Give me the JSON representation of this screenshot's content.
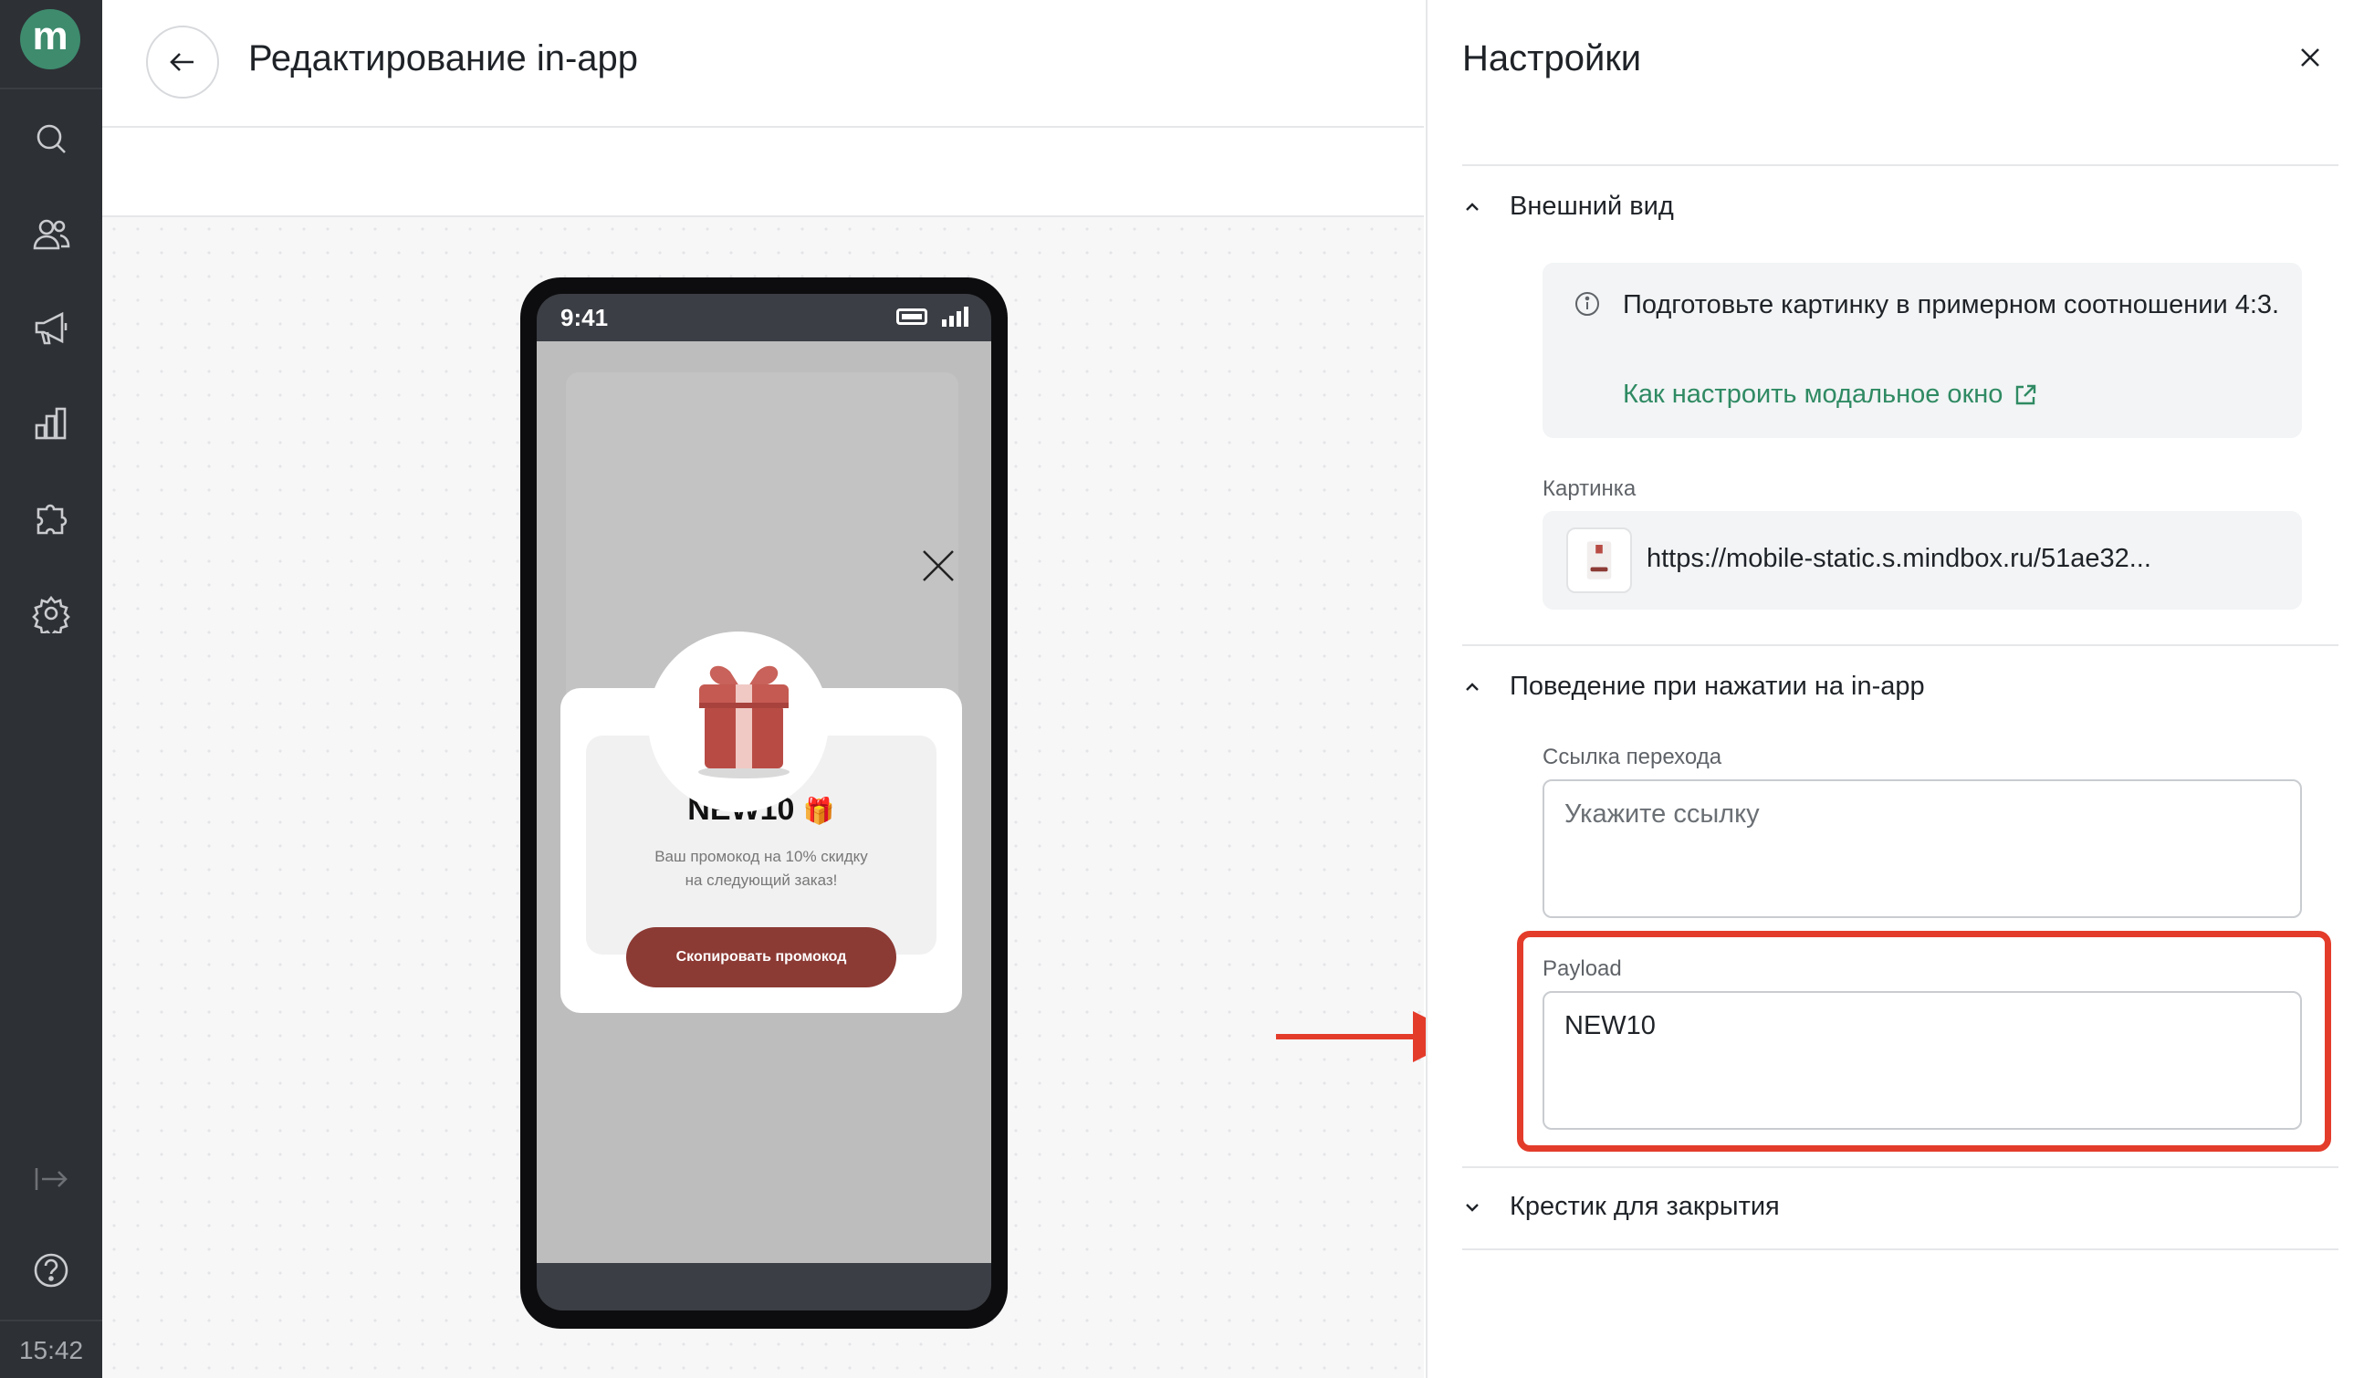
{
  "nav": {
    "logo_letter": "m",
    "time": "15:42",
    "items": [
      {
        "icon": "search-icon"
      },
      {
        "icon": "users-icon"
      },
      {
        "icon": "megaphone-icon"
      },
      {
        "icon": "analytics-icon"
      },
      {
        "icon": "puzzle-icon"
      },
      {
        "icon": "gear-icon"
      },
      {
        "icon": "logout-icon"
      },
      {
        "icon": "help-icon"
      }
    ]
  },
  "header": {
    "title": "Редактирование in-app"
  },
  "preview": {
    "status_time": "9:41",
    "promo_code": "NEW10",
    "promo_emoji": "🎁",
    "description_line1": "Ваш промокод на 10% скидку",
    "description_line2": "на следующий заказ!",
    "button_label": "Скопировать промокод"
  },
  "settings": {
    "title": "Настройки",
    "section_appearance": "Внешний вид",
    "info_text": "Подготовьте картинку в примерном соотношении 4:3.",
    "info_link": "Как настроить модальное окно",
    "image_label": "Картинка",
    "image_url": "https://mobile-static.s.mindbox.ru/51ae32...",
    "section_behavior": "Поведение при нажатии на in-app",
    "link_label": "Ссылка перехода",
    "link_placeholder": "Укажите ссылку",
    "payload_label": "Payload",
    "payload_value": "NEW10",
    "section_close": "Крестик для закрытия"
  },
  "colors": {
    "nav_bg": "#2d3035",
    "brand": "#3e8b6e",
    "link": "#2f8a63",
    "promo_button": "#8c3a34",
    "annotation": "#e43c2b"
  }
}
